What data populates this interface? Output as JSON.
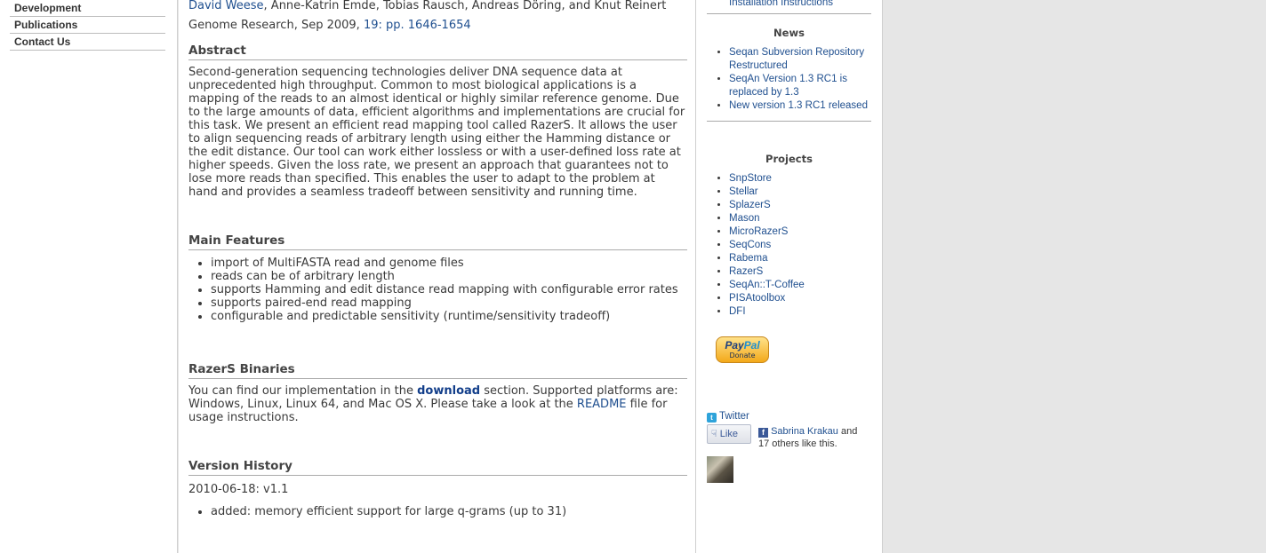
{
  "leftnav": {
    "items": [
      "Development",
      "Publications",
      "Contact Us"
    ]
  },
  "paper": {
    "authors": [
      "David Weese",
      "Anne-Katrin Emde",
      "Tobias Rausch",
      "Andreas Döring",
      "Knut Reinert"
    ],
    "journal": "Genome Research, Sep 2009,",
    "volume_pages": "19: pp. 1646-1654"
  },
  "abstract": {
    "heading": "Abstract",
    "text": "Second-generation sequencing technologies deliver DNA sequence data at unprecedented high throughput. Common to most biological applications is a mapping of the reads to an almost identical or highly similar reference genome. Due to the large amounts of data, efficient algorithms and implementations are crucial for this task. We present an efficient read mapping tool called RazerS. It allows the user to align sequencing reads of arbitrary length using either the Hamming distance or the edit distance. Our tool can work either lossless or with a user-defined loss rate at higher speeds. Given the loss rate, we present an approach that guarantees not to lose more reads than specified. This enables the user to adapt to the problem at hand and provides a seamless tradeoff between sensitivity and running time."
  },
  "features": {
    "heading": "Main Features",
    "items": [
      "import of MultiFASTA read and genome files",
      "reads can be of arbitrary length",
      "supports Hamming and edit distance read mapping with configurable error rates",
      "supports paired-end read mapping",
      "configurable and predictable sensitivity (runtime/sensitivity tradeoff)"
    ]
  },
  "binaries": {
    "heading": "RazerS Binaries",
    "text_before": "You can find our implementation in the",
    "download_link": "download",
    "text_middle": "section. Supported platforms are: Windows, Linux, Linux 64, and Mac OS X. Please take a look at the",
    "readme_link": "README",
    "text_after": "file for usage instructions."
  },
  "history": {
    "heading": "Version History",
    "version": "2010-06-18: v1.1",
    "first_item": "added: memory efficient support for large q-grams (up to 31)"
  },
  "sidebar": {
    "top_link": "Installation Instructions",
    "news_title": "News",
    "news": [
      "Seqan Subversion Repository Restructured",
      "SeqAn Version 1.3 RC1 is replaced by 1.3",
      "New version 1.3 RC1 released"
    ],
    "projects_title": "Projects",
    "projects": [
      "SnpStore",
      "Stellar",
      "SplazerS",
      "Mason",
      "MicroRazerS",
      "SeqCons",
      "Rabema",
      "RazerS",
      "SeqAn::T-Coffee",
      "PISAtoolbox",
      "DFI"
    ],
    "paypal_label_a": "Pay",
    "paypal_label_b": "Pal",
    "paypal_donate": "Donate",
    "twitter_label": "Twitter",
    "like_label": "Like",
    "fb_name": "Sabrina Krakau",
    "fb_and": "and",
    "fb_rest": "17 others like this."
  }
}
